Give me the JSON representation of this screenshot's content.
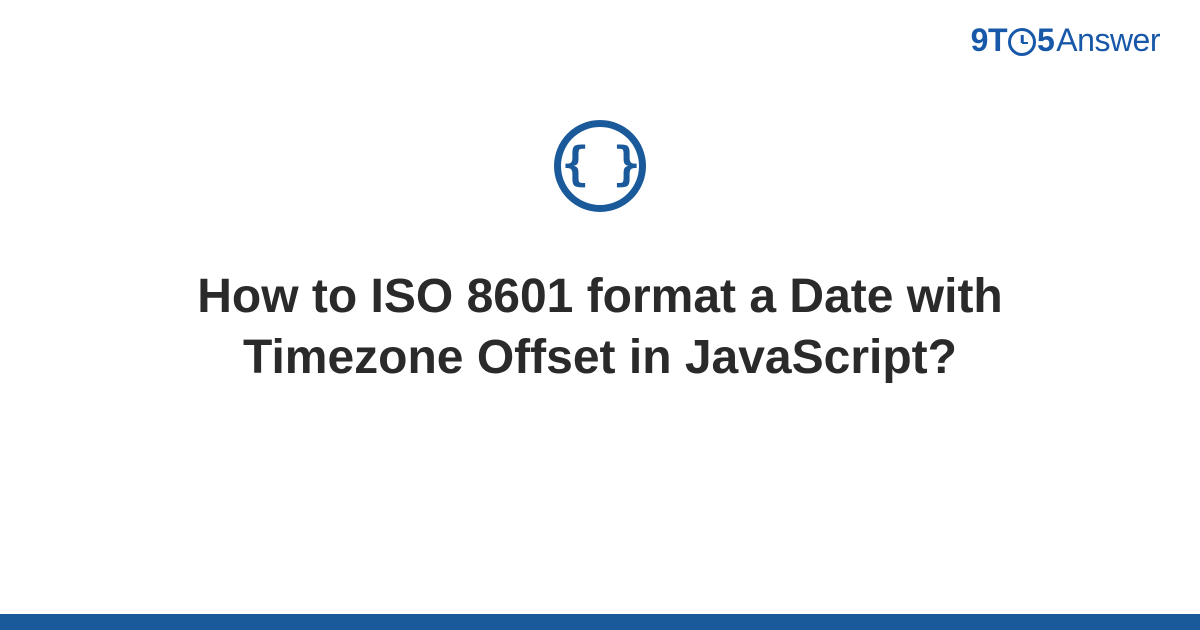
{
  "logo": {
    "nine": "9",
    "t": "T",
    "five": "5",
    "answer": "Answer"
  },
  "icon": {
    "name": "code-braces-icon",
    "glyph": "{ }"
  },
  "heading": "How to ISO 8601 format a Date with Timezone Offset in JavaScript?",
  "colors": {
    "brand": "#1b5a9a",
    "logo": "#1858a8",
    "text": "#2a2a2a"
  }
}
